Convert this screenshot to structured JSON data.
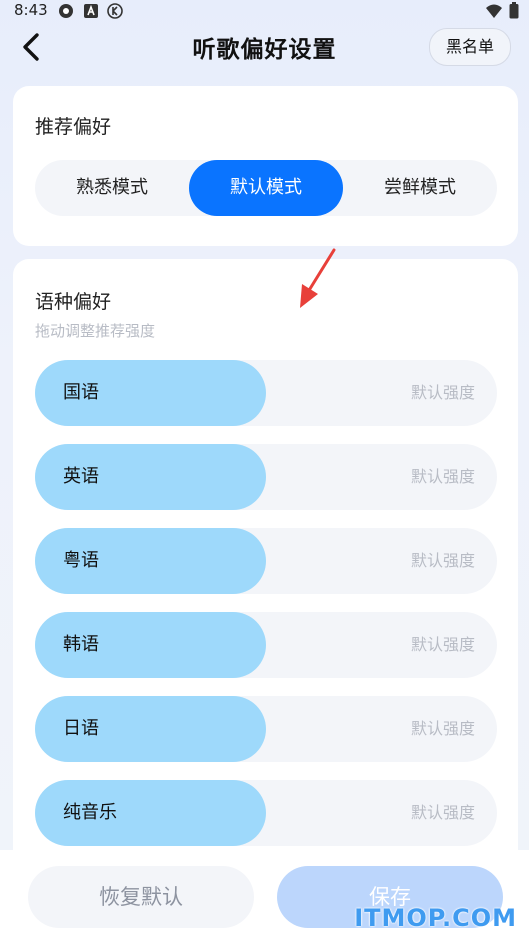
{
  "status": {
    "time": "8:43"
  },
  "header": {
    "title": "听歌偏好设置",
    "blacklist_label": "黑名单"
  },
  "recommend": {
    "title": "推荐偏好",
    "modes": [
      {
        "label": "熟悉模式",
        "active": false
      },
      {
        "label": "默认模式",
        "active": true
      },
      {
        "label": "尝鲜模式",
        "active": false
      }
    ]
  },
  "language": {
    "title": "语种偏好",
    "subtitle": "拖动调整推荐强度",
    "items": [
      {
        "name": "国语",
        "strength": "默认强度",
        "level": 0.5
      },
      {
        "name": "英语",
        "strength": "默认强度",
        "level": 0.5
      },
      {
        "name": "粤语",
        "strength": "默认强度",
        "level": 0.5
      },
      {
        "name": "韩语",
        "strength": "默认强度",
        "level": 0.5
      },
      {
        "name": "日语",
        "strength": "默认强度",
        "level": 0.5
      },
      {
        "name": "纯音乐",
        "strength": "默认强度",
        "level": 0.5
      }
    ]
  },
  "footer": {
    "reset_label": "恢复默认",
    "save_label": "保存"
  },
  "watermark": "ITMOP.COM",
  "colors": {
    "accent": "#0a74ff",
    "slider_fill": "#9ed9fb",
    "save_disabled": "#bcd6fc"
  }
}
